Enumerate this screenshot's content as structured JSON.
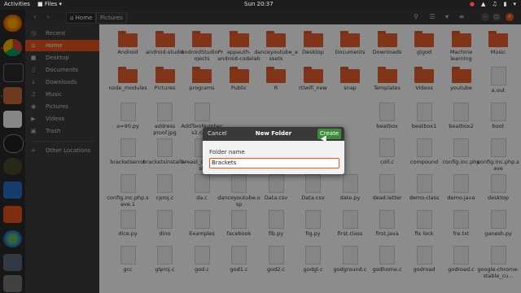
{
  "topbar": {
    "activities": "Activities",
    "app_menu": "Files",
    "clock": "Sun 20:37"
  },
  "header": {
    "crumb_home": "Home",
    "crumb_current": "Pictures"
  },
  "sidebar": {
    "items": [
      {
        "label": "Recent",
        "icon": "clock-icon"
      },
      {
        "label": "Home",
        "icon": "home-icon"
      },
      {
        "label": "Desktop",
        "icon": "folder-icon"
      },
      {
        "label": "Documents",
        "icon": "document-icon"
      },
      {
        "label": "Downloads",
        "icon": "download-icon"
      },
      {
        "label": "Music",
        "icon": "music-icon"
      },
      {
        "label": "Pictures",
        "icon": "camera-icon"
      },
      {
        "label": "Videos",
        "icon": "video-icon"
      },
      {
        "label": "Trash",
        "icon": "trash-icon"
      }
    ],
    "other": "Other Locations"
  },
  "files": [
    [
      "Android",
      "android-studio",
      "AndroidStudioProjects",
      "appauth-android-codelab",
      "danceyoutube_assets",
      "Desktop",
      "Documents",
      "Downloads",
      "glgod",
      "Machine learning",
      "Music"
    ],
    [
      "node_modules",
      "Pictures",
      "programs",
      "Public",
      "R",
      "rtlwifi_new",
      "snap",
      "Templates",
      "Videos",
      "youtube",
      "a.out"
    ],
    [
      "a=90.py",
      "address proof.jpg",
      "AddTwoNumbers2.class",
      "",
      "",
      "",
      "",
      "beatbox",
      "beatbox1",
      "beatbox2",
      "boot"
    ],
    [
      "bracketserror",
      "bracketsinstaller",
      "breast_cancer.csv",
      "",
      "",
      "",
      "",
      "coll.c",
      "compound",
      "config.inc.php",
      "config.inc.php.save"
    ],
    [
      "config.inc.php.save.1",
      "cproj.c",
      "da.c",
      "danceyoutube.osp",
      "Data.csv",
      "Data.csv",
      "date.py",
      "dead.letter",
      "demo.class",
      "demo.java",
      "desktop"
    ],
    [
      "dice.py",
      "dino",
      "Examples",
      "facebook",
      "fib.py",
      "fig.py",
      "first.class",
      "first.java",
      "flx lock",
      "fre.txt",
      "ganesh.py"
    ],
    [
      "gcc",
      "glproj.c",
      "god.c",
      "god1.c",
      "god2.c",
      "godgl.c",
      "godground.c",
      "godhome.c",
      "godroad",
      "godroad.c",
      "google-chrome-stable_cu..."
    ]
  ],
  "dialog": {
    "cancel": "Cancel",
    "title": "New Folder",
    "create": "Create",
    "field_label": "Folder name",
    "field_value": "Brackets"
  },
  "colors": {
    "accent": "#e95420",
    "create_button": "#3d8a3a",
    "folder": "#e95f2f"
  }
}
